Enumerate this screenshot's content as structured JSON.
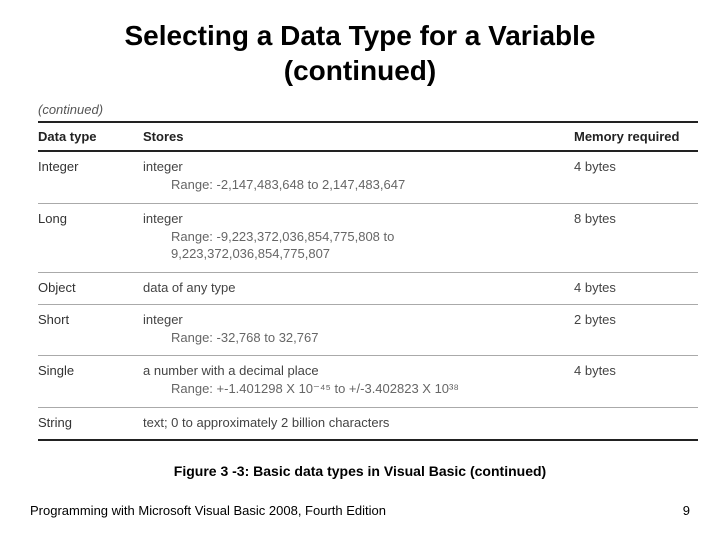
{
  "title_line1": "Selecting a Data Type for a Variable",
  "title_line2": "(continued)",
  "continued_note": "(continued)",
  "headers": {
    "datatype": "Data type",
    "stores": "Stores",
    "memory": "Memory required"
  },
  "rows": [
    {
      "datatype": "Integer",
      "stores_main": "integer",
      "stores_range": "Range: -2,147,483,648 to 2,147,483,647",
      "memory": "4 bytes"
    },
    {
      "datatype": "Long",
      "stores_main": "integer",
      "stores_range": "Range: -9,223,372,036,854,775,808 to 9,223,372,036,854,775,807",
      "memory": "8 bytes"
    },
    {
      "datatype": "Object",
      "stores_main": "data of any type",
      "stores_range": "",
      "memory": "4 bytes"
    },
    {
      "datatype": "Short",
      "stores_main": "integer",
      "stores_range": "Range: -32,768 to 32,767",
      "memory": "2 bytes"
    },
    {
      "datatype": "Single",
      "stores_main": "a number with a decimal place",
      "stores_range": "Range: +-1.401298 X 10⁻⁴⁵ to +/-3.402823 X 10³⁸",
      "memory": "4 bytes"
    },
    {
      "datatype": "String",
      "stores_main": "text; 0 to approximately 2 billion characters",
      "stores_range": "",
      "memory": ""
    }
  ],
  "caption": "Figure 3 -3: Basic data types in Visual Basic (continued)",
  "footer_text": "Programming with Microsoft Visual Basic 2008, Fourth Edition",
  "page_number": "9",
  "chart_data": {
    "type": "table",
    "columns": [
      "Data type",
      "Stores",
      "Memory required"
    ],
    "rows": [
      [
        "Integer",
        "integer; Range: -2,147,483,648 to 2,147,483,647",
        "4 bytes"
      ],
      [
        "Long",
        "integer; Range: -9,223,372,036,854,775,808 to 9,223,372,036,854,775,807",
        "8 bytes"
      ],
      [
        "Object",
        "data of any type",
        "4 bytes"
      ],
      [
        "Short",
        "integer; Range: -32,768 to 32,767",
        "2 bytes"
      ],
      [
        "Single",
        "a number with a decimal place; Range: +-1.401298 X 10^-45 to +/-3.402823 X 10^38",
        "4 bytes"
      ],
      [
        "String",
        "text; 0 to approximately 2 billion characters",
        ""
      ]
    ],
    "title": "Figure 3-3: Basic data types in Visual Basic (continued)"
  }
}
